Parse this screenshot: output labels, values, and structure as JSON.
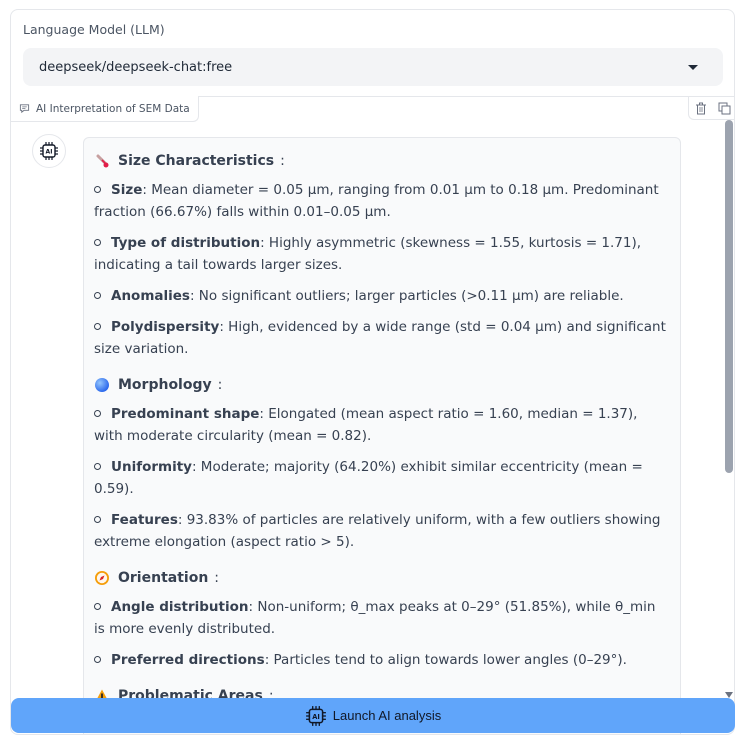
{
  "llm": {
    "label": "Language Model (LLM)",
    "selected": "deepseek/deepseek-chat:free"
  },
  "panel": {
    "tab_label": "AI Interpretation of SEM Data",
    "icons": [
      "trash-icon",
      "copy-icon"
    ]
  },
  "sections": [
    {
      "emoji": "thermometer",
      "title": "Size Characteristics",
      "items": [
        {
          "key": "Size",
          "text": ": Mean diameter = 0.05 µm, ranging from 0.01 µm to 0.18 µm. Predominant fraction (66.67%) falls within 0.01–0.05 µm."
        },
        {
          "key": "Type of distribution",
          "text": ": Highly asymmetric (skewness = 1.55, kurtosis = 1.71), indicating a tail towards larger sizes."
        },
        {
          "key": "Anomalies",
          "text": ": No significant outliers; larger particles (>0.11 µm) are reliable."
        },
        {
          "key": "Polydispersity",
          "text": ": High, evidenced by a wide range (std = 0.04 µm) and significant size variation."
        }
      ]
    },
    {
      "emoji": "blue-circle",
      "title": "Morphology",
      "items": [
        {
          "key": "Predominant shape",
          "text": ": Elongated (mean aspect ratio = 1.60, median = 1.37), with moderate circularity (mean = 0.82)."
        },
        {
          "key": "Uniformity",
          "text": ": Moderate; majority (64.20%) exhibit similar eccentricity (mean = 0.59)."
        },
        {
          "key": "Features",
          "text": ": 93.83% of particles are relatively uniform, with a few outliers showing extreme elongation (aspect ratio > 5)."
        }
      ]
    },
    {
      "emoji": "compass",
      "title": "Orientation",
      "items": [
        {
          "key": "Angle distribution",
          "text": ": Non-uniform; θ_max peaks at 0–29° (51.85%), while θ_min is more evenly distributed."
        },
        {
          "key": "Preferred directions",
          "text": ": Particles tend to align towards lower angles (0–29°)."
        }
      ]
    },
    {
      "emoji": "warning",
      "title": "Problematic Areas",
      "items": []
    }
  ],
  "launch_button": "Launch AI analysis",
  "colors": {
    "accent": "#60a5fa"
  }
}
